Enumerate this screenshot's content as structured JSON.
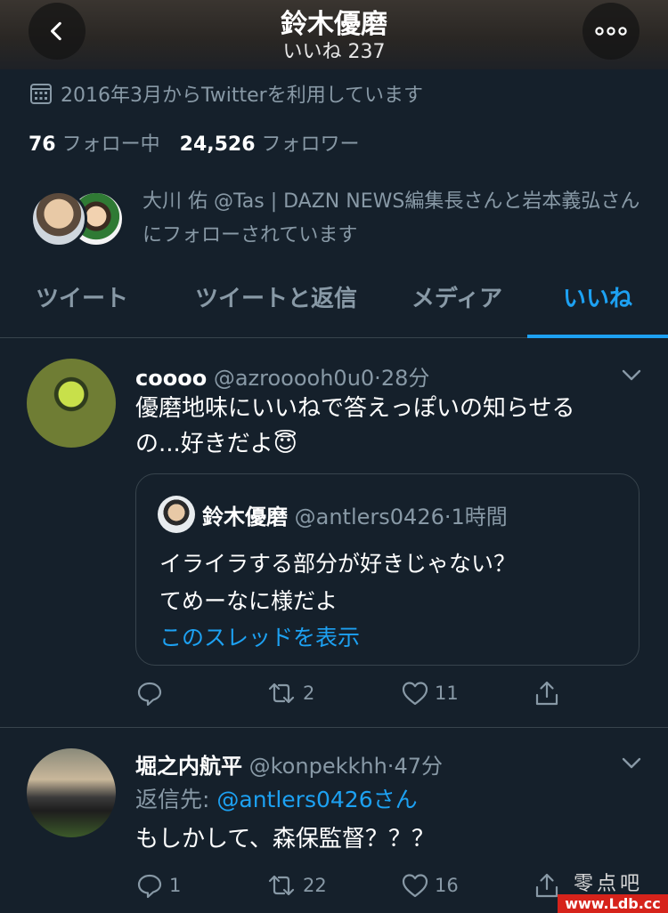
{
  "header": {
    "title": "鈴木優磨",
    "subtitle": "いいね 237",
    "back_icon": "chevron-left-icon",
    "more_icon": "more-horizontal-icon"
  },
  "profile": {
    "joined": "2016年3月からTwitterを利用しています",
    "following_count": "76",
    "following_label": "フォロー中",
    "followers_count": "24,526",
    "followers_label": "フォロワー",
    "followed_by_text": "大川 佑 @Tas | DAZN NEWS編集長さんと岩本義弘さんにフォローされています"
  },
  "tabs": [
    {
      "label": "ツイート",
      "active": false
    },
    {
      "label": "ツイートと返信",
      "active": false
    },
    {
      "label": "メディア",
      "active": false
    },
    {
      "label": "いいね",
      "active": true
    }
  ],
  "colors": {
    "accent": "#1da1f2",
    "background": "#15202b",
    "muted": "#8899a6",
    "border": "#38444d"
  },
  "tweets": [
    {
      "name": "coooo",
      "handle": "@azrooooh0u0",
      "time": "28分",
      "text_line1": "優磨地味にいいねで答えっぽいの知らせる",
      "text_line2": "の...好きだよ😇",
      "quote": {
        "name": "鈴木優磨",
        "handle": "@antlers0426",
        "time": "1時間",
        "text_line1": "イライラする部分が好きじゃない？",
        "text_line2": "てめーなに様だよ",
        "thread_link": "このスレッドを表示"
      },
      "replies": "",
      "retweets": "2",
      "likes": "11"
    },
    {
      "name": "堀之内航平",
      "handle": "@konpekkhh",
      "time": "47分",
      "reply_to_label": "返信先: ",
      "reply_to_handle": "@antlers0426さん",
      "text": "もしかして、森保監督？？？",
      "replies": "1",
      "retweets": "22",
      "likes": "16"
    }
  ],
  "watermark": {
    "text": "零点吧",
    "url": "www.Ldb.cc"
  }
}
